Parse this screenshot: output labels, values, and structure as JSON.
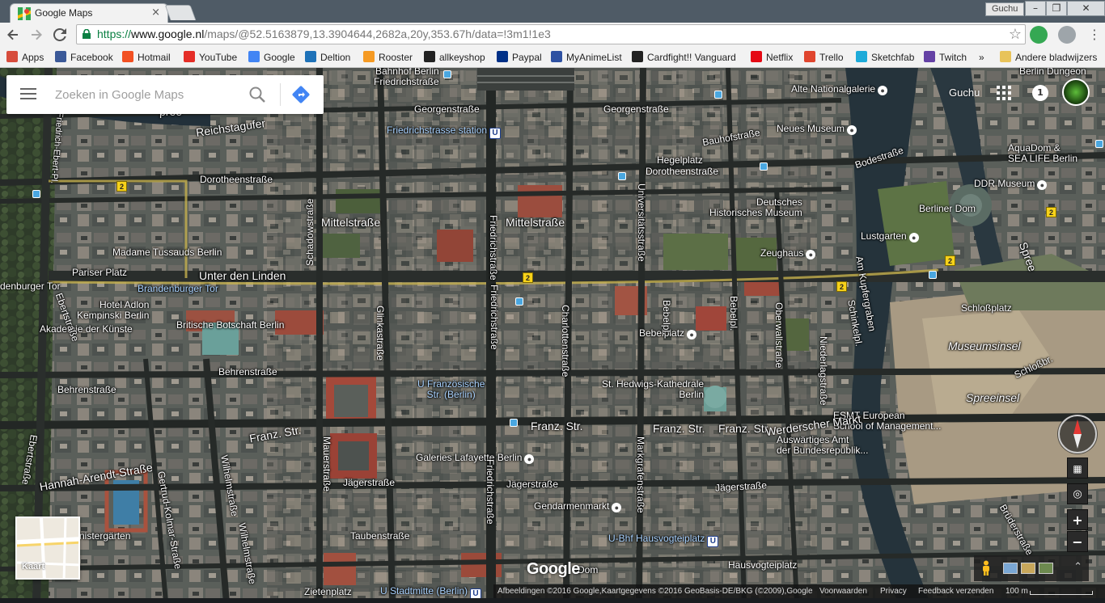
{
  "browser": {
    "tab_title": "Google Maps",
    "tab_close": "×",
    "user": "Guchu",
    "win_min": "–",
    "win_max": "❐",
    "win_close": "✕",
    "url_scheme": "https://",
    "url_host": "www.google.nl",
    "url_path": "/maps/@52.5163879,13.3904644,2682a,20y,353.67h/data=!3m1!1e3",
    "bookmarks": [
      {
        "label": "Apps",
        "color": "#d74c3c"
      },
      {
        "label": "Facebook",
        "color": "#3b5998"
      },
      {
        "label": "Hotmail",
        "color": "#f25022"
      },
      {
        "label": "YouTube",
        "color": "#e52d27"
      },
      {
        "label": "Google",
        "color": "#4285f4"
      },
      {
        "label": "Deltion",
        "color": "#1e72b8"
      },
      {
        "label": "Rooster",
        "color": "#f59a23"
      },
      {
        "label": "allkeyshop",
        "color": "#222222"
      },
      {
        "label": "Paypal",
        "color": "#003087"
      },
      {
        "label": "MyAnimeList",
        "color": "#2e51a2"
      },
      {
        "label": "Cardfight!! Vanguard",
        "color": "#222222"
      },
      {
        "label": "Netflix",
        "color": "#e50914"
      },
      {
        "label": "Trello",
        "color": "#e0452e"
      },
      {
        "label": "Sketchfab",
        "color": "#1caad9"
      },
      {
        "label": "Twitch",
        "color": "#6441a5"
      }
    ],
    "bookmarks_overflow": "»",
    "other_bookmarks": "Andere bladwijzers"
  },
  "maps": {
    "search_placeholder": "Zoeken in Google Maps",
    "account_name": "Guchu",
    "notification_count": "1",
    "logo": "Google",
    "minimap_label": "Kaart",
    "footer": {
      "imagery": "Afbeeldingen ©2016 Google,Kaartgegevens ©2016 GeoBasis-DE/BKG (©2009),Google",
      "terms": "Voorwaarden",
      "privacy": "Privacy",
      "feedback": "Feedback verzenden",
      "scale": "100 m"
    },
    "labels": {
      "bahnhof": "Bahnhof Berlin\nFriedrichstraße",
      "georgen1": "Georgenstraße",
      "georgen2": "Georgenstraße",
      "friedrichstrasse_station": "Friedrichstrasse station",
      "reichstagufer": "Reichstagufer",
      "dorotheen1": "Dorotheenstraße",
      "hegelplatz": "Hegelplatz",
      "dorotheen2": "Dorotheenstraße",
      "bauhof": "Bauhofstraße",
      "alte_nationalgalerie": "Alte Nationalgalerie",
      "neues_museum": "Neues Museum",
      "berlin_dungeon": "Berlin Dungeon",
      "aquadom": "AquaDom &\nSEA LIFE Berlin",
      "ddr_museum": "DDR Museum",
      "bodestrasse": "Bodestraße",
      "berliner_dom": "Berliner Dom",
      "lustgarten": "Lustgarten",
      "mittel1": "Mittelstraße",
      "mittel2": "Mittelstraße",
      "deutsches_museum": "Deutsches\nHistorisches Museum",
      "zeughaus": "Zeughaus",
      "madame_tussauds": "Madame Tussauds Berlin",
      "pariser_platz": "Pariser Platz",
      "unter_den_linden": "Unter den Linden",
      "brandenburger_tor_left": "denburger Tor",
      "brandenburger_tor": "Brandenburger Tor",
      "hotel_adlon": "Hotel Adlon\nKempinski Berlin",
      "akademie": "Akademie der Künste",
      "britische_botschaft": "Britische Botschaft Berlin",
      "behren1": "Behrenstraße",
      "behren2": "Behrenstraße",
      "bebelplatz": "Bebelplatz",
      "schlossplatz": "Schloßplatz",
      "museumsinsel": "Museumsinsel",
      "spreeinsel": "Spreeinsel",
      "u_franzoesische": "U Französische\nStr. (Berlin)",
      "hedwigs": "St. Hedwigs-Kathedrale\nBerlin",
      "franz1": "Franz. Str.",
      "franz2": "Franz. Str.",
      "franz3": "Franz. Str.",
      "franz4": "Franz. Str.",
      "esmt": "ESMT European\nSchool of Management...",
      "werderscher": "Werderscher Markt",
      "auswaertiges": "Auswärtiges Amt\nder Bundesrepublik...",
      "hannah_arendt": "Hannah-Arendt-Straße",
      "galeries": "Galeries Lafayette Berlin",
      "jaeger1": "Jägerstraße",
      "jaeger2": "Jägerstraße",
      "jaeger3": "Jägerstraße",
      "gendarmenmarkt": "Gendarmenmarkt",
      "u_hausvogteiplatz": "U-Bhf Hausvogteiplatz",
      "hausvogteiplatz": "Hausvogteiplatz",
      "tauben": "Taubenstraße",
      "ministergaerten": "nistergärten",
      "zietenplatz": "Zietenplatz",
      "u_stadtmitte": "U Stadtmitte (Berlin)",
      "dom": "Dom",
      "schadow": "Schadowstraße",
      "friedrich_v1": "Friedrichstraße",
      "friedrich_v2": "Friedrichstraße",
      "friedrich_v3": "Friedrichstraße",
      "universitaets": "Universitätsstraße",
      "charlotten": "Charlottenstraße",
      "glinka": "Glinkastraße",
      "mauer": "Mauerstraße",
      "wilhelm1": "Wilhelmstraße",
      "wilhelm2": "Wilhelmstraße",
      "markgrafen": "Markgrafenstraße",
      "oberwall": "Oberwallstraße",
      "niederlag": "Niederlagstraße",
      "kupfergraben": "Am Kupfergraben",
      "spree": "Spree",
      "ebert1": "Ebertstraße",
      "ebert2": "Ebertstraße",
      "gertrud": "Gertrud-Kolmar-Straße",
      "friedrich_ebert": "Friedrich-Ebert-Pl.",
      "bruederstr": "Brüderstraße",
      "schlossbr": "Schloßbr.",
      "schinkelpl": "Schinkelpl.",
      "bebelpl_v": "Bebelpl.",
      "spree_left": "pree",
      "behren_v": "Bebelpl."
    },
    "road_number": "2",
    "poi_glyph": "●",
    "ubahn_glyph": "U",
    "controls": {
      "zoom_in": "+",
      "zoom_out": "−",
      "locate": "◎",
      "tilt": "▦",
      "expand": "⌃"
    }
  }
}
